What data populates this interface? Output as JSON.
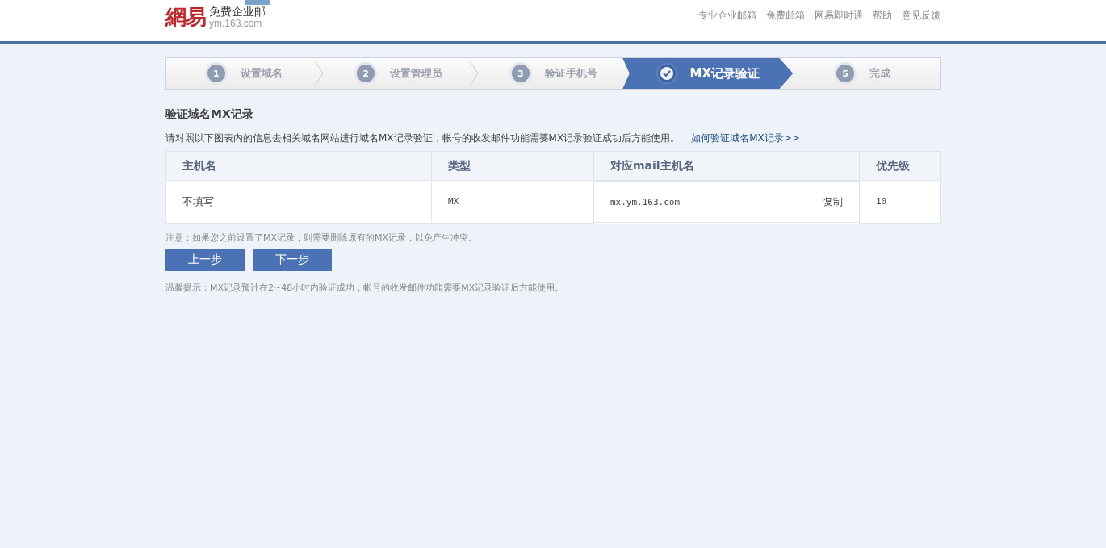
{
  "header": {
    "logo": "網易",
    "product": "免费企业邮",
    "domain": "ym.163.com",
    "nav": [
      "专业企业邮箱",
      "免费邮箱",
      "网易即时通",
      "帮助",
      "意见反馈"
    ]
  },
  "steps": [
    {
      "number": "1",
      "label": "设置域名",
      "selected": false
    },
    {
      "number": "2",
      "label": "设置管理员",
      "selected": false
    },
    {
      "number": "3",
      "label": "验证手机号",
      "selected": false
    },
    {
      "label": "MX记录验证",
      "selected": true
    },
    {
      "number": "5",
      "label": "完成",
      "selected": false
    }
  ],
  "section_title": "验证域名MX记录",
  "intro": "请对照以下图表内的信息去相关域名网站进行域名MX记录验证，帐号的收发邮件功能需要MX记录验证成功后方能使用。",
  "help_link": "如何验证域名MX记录>>",
  "table": {
    "columns": [
      "主机名",
      "类型",
      "对应mail主机名",
      "优先级"
    ],
    "rows": [
      {
        "host": "不填写",
        "type": "MX",
        "mail_host": "mx.ym.163.com",
        "copy": "复制",
        "priority": "10"
      }
    ]
  },
  "note": "注意：如果您之前设置了MX记录，则需要删除原有的MX记录，以免产生冲突。",
  "buttons": [
    "上一步",
    "下一步"
  ],
  "tip": "温馨提示：MX记录预计在2~48小时内验证成功，帐号的收发邮件功能需要MX记录验证后方能使用。"
}
